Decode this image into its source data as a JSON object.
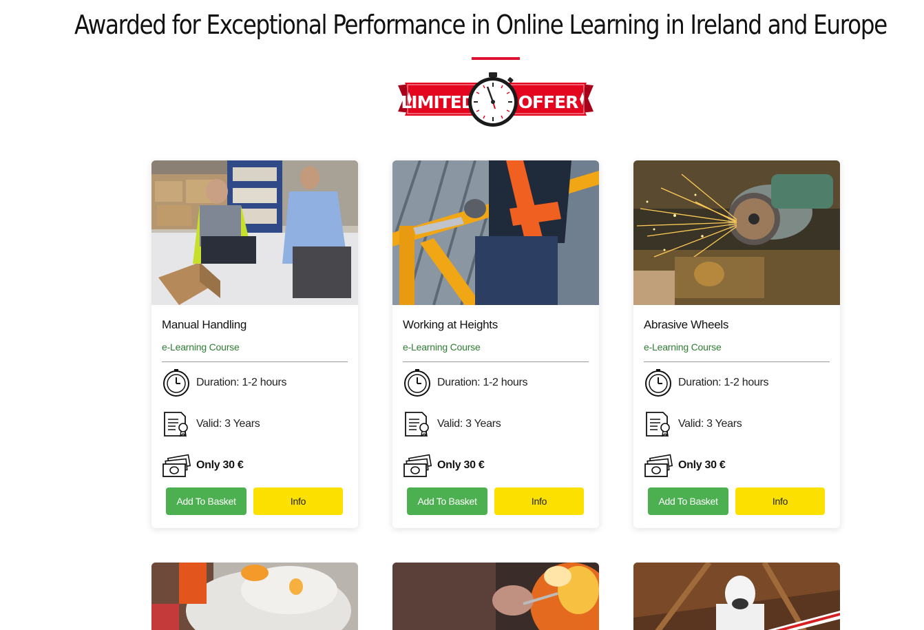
{
  "headline": "Awarded for Exceptional Performance in Online Learning in Ireland and Europe",
  "offer_badge": {
    "left_text": "LIMITED",
    "right_text": "OFFER"
  },
  "courses": [
    {
      "title": "Manual Handling",
      "subtitle": "e-Learning Course",
      "duration": "Duration: 1-2 hours",
      "valid": "Valid: 3 Years",
      "price": "Only 30 €",
      "add_label": "Add To Basket",
      "info_label": "Info"
    },
    {
      "title": "Working at Heights",
      "subtitle": "e-Learning Course",
      "duration": "Duration: 1-2 hours",
      "valid": "Valid: 3 Years",
      "price": "Only 30 €",
      "add_label": "Add To Basket",
      "info_label": "Info"
    },
    {
      "title": "Abrasive Wheels",
      "subtitle": "e-Learning Course",
      "duration": "Duration: 1-2 hours",
      "valid": "Valid: 3 Years",
      "price": "Only 30 €",
      "add_label": "Add To Basket",
      "info_label": "Info"
    }
  ],
  "colors": {
    "accent_red": "#e0102e",
    "subtitle_green": "#2e7d32",
    "basket_green": "#4caf50",
    "info_yellow": "#fbe000"
  }
}
